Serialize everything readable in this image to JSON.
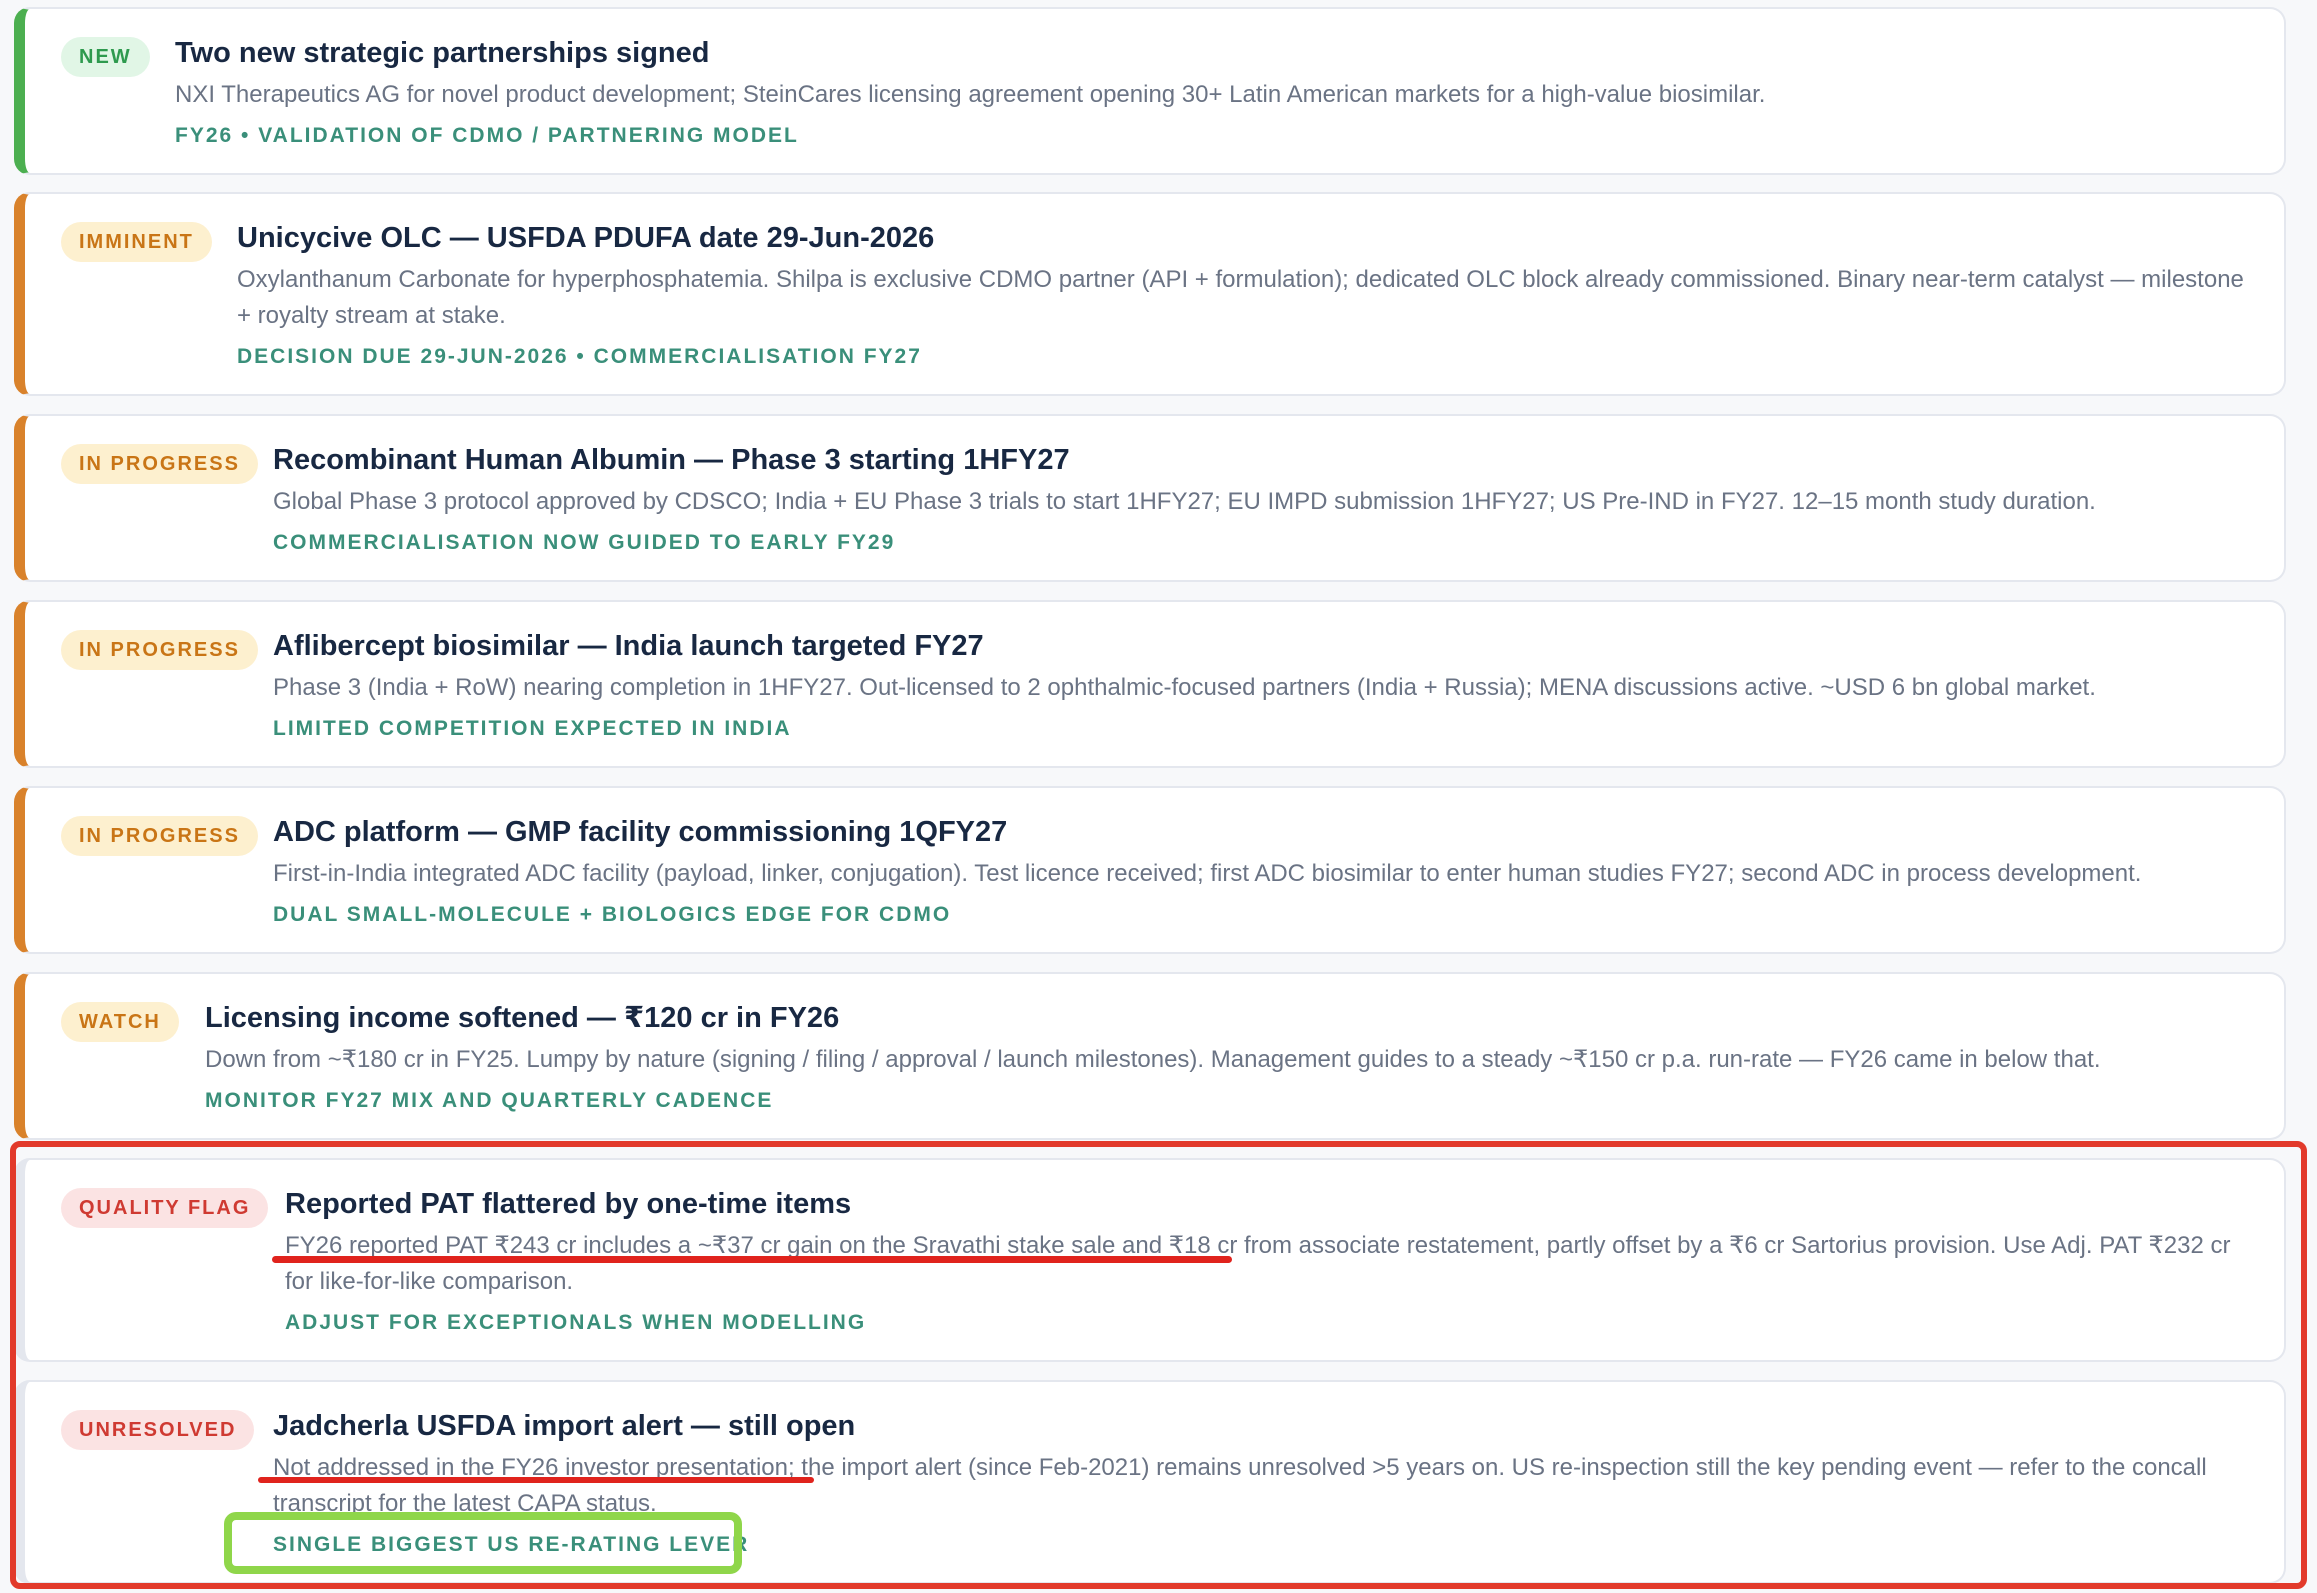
{
  "colors": {
    "green": "#4caf50",
    "orange": "#d9822b",
    "red": "#e23a2b",
    "tag": "#3a8f7a",
    "badge_green_bg": "#e1f6e6",
    "badge_green_fg": "#2e9a4e",
    "badge_amber_bg": "#fdf0cf",
    "badge_amber_fg": "#c97516",
    "badge_red_bg": "#fbe3e3",
    "badge_red_fg": "#cf3a32",
    "highlight_green": "#8fd64a"
  },
  "cards": [
    {
      "badge": "NEW",
      "tone": "green",
      "title": "Two new strategic partnerships signed",
      "desc": "NXI Therapeutics AG for novel product development; SteinCares licensing agreement opening 30+ Latin American markets for a high-value biosimilar.",
      "tag": "FY26 • VALIDATION OF CDMO / PARTNERING MODEL"
    },
    {
      "badge": "IMMINENT",
      "tone": "orange",
      "title": "Unicycive OLC — USFDA PDUFA date 29-Jun-2026",
      "desc": "Oxylanthanum Carbonate for hyperphosphatemia. Shilpa is exclusive CDMO partner (API + formulation); dedicated OLC block already commissioned. Binary near-term catalyst — milestone + royalty stream at stake.",
      "tag": "DECISION DUE 29-JUN-2026 • COMMERCIALISATION FY27"
    },
    {
      "badge": "IN PROGRESS",
      "tone": "orange",
      "title": "Recombinant Human Albumin — Phase 3 starting 1HFY27",
      "desc": "Global Phase 3 protocol approved by CDSCO; India + EU Phase 3 trials to start 1HFY27; EU IMPD submission 1HFY27; US Pre-IND in FY27. 12–15 month study duration.",
      "tag": "COMMERCIALISATION NOW GUIDED TO EARLY FY29"
    },
    {
      "badge": "IN PROGRESS",
      "tone": "orange",
      "title": "Aflibercept biosimilar — India launch targeted FY27",
      "desc": "Phase 3 (India + RoW) nearing completion in 1HFY27. Out-licensed to 2 ophthalmic-focused partners (India + Russia); MENA discussions active. ~USD 6 bn global market.",
      "tag": "LIMITED COMPETITION EXPECTED IN INDIA"
    },
    {
      "badge": "IN PROGRESS",
      "tone": "orange",
      "title": "ADC platform — GMP facility commissioning 1QFY27",
      "desc": "First-in-India integrated ADC facility (payload, linker, conjugation). Test licence received; first ADC biosimilar to enter human studies FY27; second ADC in process development.",
      "tag": "DUAL SMALL-MOLECULE + BIOLOGICS EDGE FOR CDMO"
    },
    {
      "badge": "WATCH",
      "tone": "orange",
      "title": "Licensing income softened — ₹120 cr in FY26",
      "desc": "Down from ~₹180 cr in FY25. Lumpy by nature (signing / filing / approval / launch milestones). Management guides to a steady ~₹150 cr p.a. run-rate — FY26 came in below that.",
      "tag": "MONITOR FY27 MIX AND QUARTERLY CADENCE"
    },
    {
      "badge": "QUALITY FLAG",
      "tone": "red",
      "title": "Reported PAT flattered by one-time items",
      "desc": "FY26 reported PAT ₹243 cr includes a ~₹37 cr gain on the Sravathi stake sale and ₹18 cr from associate restatement, partly offset by a ₹6 cr Sartorius provision. Use Adj. PAT ₹232 cr for like-for-like comparison.",
      "tag": "ADJUST FOR EXCEPTIONALS WHEN MODELLING"
    },
    {
      "badge": "UNRESOLVED",
      "tone": "red",
      "title": "Jadcherla USFDA import alert — still open",
      "desc": "Not addressed in the FY26 investor presentation; the import alert (since Feb-2021) remains unresolved >5 years on. US re-inspection still the key pending event — refer to the concall transcript for the latest CAPA status.",
      "tag": "SINGLE BIGGEST US RE-RATING LEVER"
    }
  ]
}
